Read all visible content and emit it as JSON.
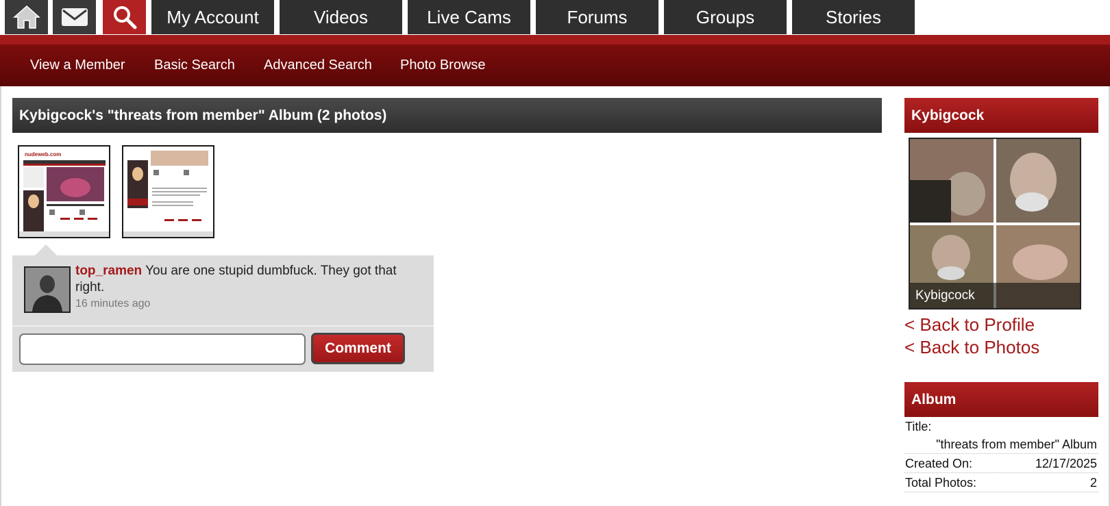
{
  "topnav": {
    "tabs": [
      {
        "label": "My Account"
      },
      {
        "label": "Videos"
      },
      {
        "label": "Live Cams"
      },
      {
        "label": "Forums"
      },
      {
        "label": "Groups"
      },
      {
        "label": "Stories"
      }
    ],
    "icons": [
      "home-icon",
      "mail-icon",
      "search-icon"
    ]
  },
  "subnav": {
    "items": [
      "View a Member",
      "Basic Search",
      "Advanced Search",
      "Photo Browse"
    ]
  },
  "album": {
    "header": "Kybigcock's \"threats from member\" Album (2 photos)",
    "thumbnail_logo": "nudeweb.com"
  },
  "comment": {
    "user": "top_ramen",
    "text": "You are one stupid dumbfuck. They got that right.",
    "time": "16 minutes ago",
    "input_value": "",
    "button_label": "Comment"
  },
  "sidebar": {
    "profile_title": "Kybigcock",
    "profile_caption": "Kybigcock",
    "back_profile": "< Back to Profile",
    "back_photos": "< Back to Photos",
    "album_title": "Album",
    "rows": [
      {
        "label": "Title:",
        "value": "\"threats from member\" Album"
      },
      {
        "label": "Created On:",
        "value": "12/17/2025"
      },
      {
        "label": "Total Photos:",
        "value": "2"
      }
    ]
  },
  "colors": {
    "brand_red": "#a31a1a",
    "nav_dark": "#2f2f2f",
    "subnav": "#6b0a0a"
  }
}
